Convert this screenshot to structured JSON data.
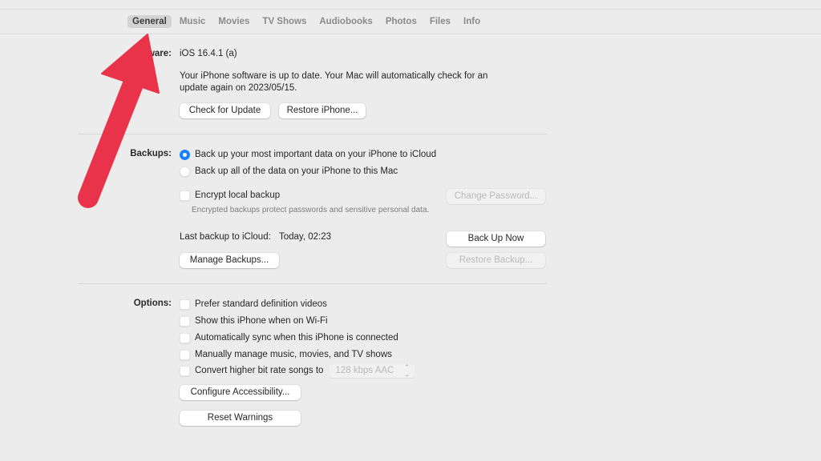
{
  "tabs": [
    {
      "label": "General",
      "active": true
    },
    {
      "label": "Music",
      "active": false
    },
    {
      "label": "Movies",
      "active": false
    },
    {
      "label": "TV Shows",
      "active": false
    },
    {
      "label": "Audiobooks",
      "active": false
    },
    {
      "label": "Photos",
      "active": false
    },
    {
      "label": "Files",
      "active": false
    },
    {
      "label": "Info",
      "active": false
    }
  ],
  "software": {
    "label": "Software:",
    "visible_label": "ware:",
    "version": "iOS 16.4.1 (a)",
    "status_line1": "Your iPhone software is up to date. Your Mac will automatically check for an",
    "status_line2": "update again on 2023/05/15.",
    "check_button": "Check for Update",
    "restore_button": "Restore iPhone..."
  },
  "backups": {
    "label": "Backups:",
    "options": [
      {
        "label": "Back up your most important data on your iPhone to iCloud",
        "selected": true
      },
      {
        "label": "Back up all of the data on your iPhone to this Mac",
        "selected": false
      }
    ],
    "encrypt": {
      "label": "Encrypt local backup",
      "checked": false
    },
    "encrypt_note": "Encrypted backups protect passwords and sensitive personal data.",
    "change_password_button": "Change Password...",
    "last_backup_label": "Last backup to iCloud:",
    "last_backup_value": "Today, 02:23",
    "back_up_now_button": "Back Up Now",
    "manage_backups_button": "Manage Backups...",
    "restore_backup_button": "Restore Backup..."
  },
  "options": {
    "label": "Options:",
    "checkboxes": [
      {
        "label": "Prefer standard definition videos",
        "checked": false
      },
      {
        "label": "Show this iPhone when on Wi-Fi",
        "checked": false
      },
      {
        "label": "Automatically sync when this iPhone is connected",
        "checked": false
      },
      {
        "label": "Manually manage music, movies, and TV shows",
        "checked": false
      },
      {
        "label": "Convert higher bit rate songs to",
        "checked": false
      }
    ],
    "bitrate_select": "128 kbps AAC",
    "configure_accessibility_button": "Configure Accessibility...",
    "reset_warnings_button": "Reset Warnings"
  },
  "annotation": {
    "type": "arrow",
    "color": "#e8334a",
    "points_to": "General tab"
  }
}
